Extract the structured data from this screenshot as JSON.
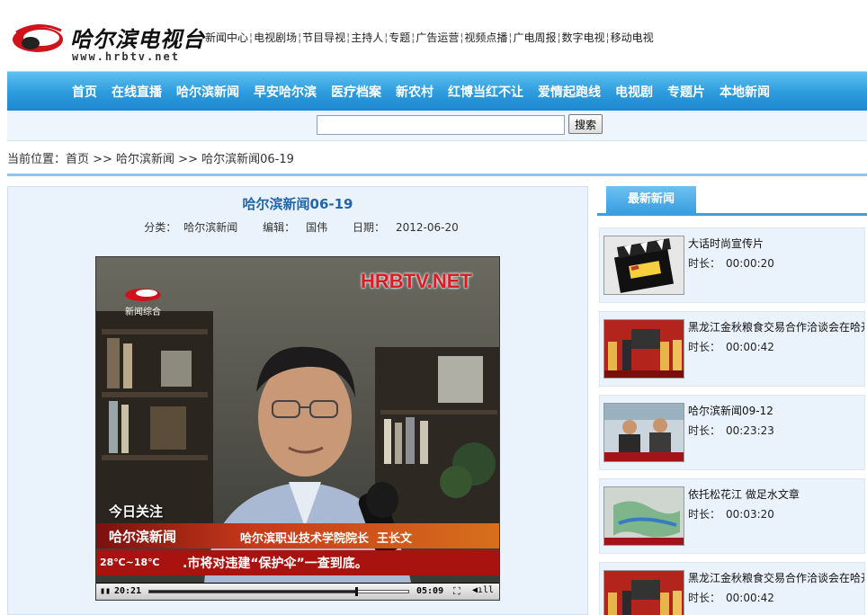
{
  "header": {
    "logo_text": "哈尔滨电视台",
    "logo_url": "www.hrbtv.net",
    "top_links": [
      "新闻中心",
      "电视剧场",
      "节目导视",
      "主持人",
      "专题",
      "广告运营",
      "视频点播",
      "广电周报",
      "数字电视",
      "移动电视"
    ],
    "separator": "¦"
  },
  "nav": {
    "items": [
      "首页",
      "在线直播",
      "哈尔滨新闻",
      "早安哈尔滨",
      "医疗档案",
      "新农村",
      "红博当红不让",
      "爱情起跑线",
      "电视剧",
      "专题片",
      "本地新闻"
    ]
  },
  "search": {
    "value": "",
    "button_label": "搜索"
  },
  "breadcrumb": {
    "text": "当前位置：首页 >> 哈尔滨新闻 >> 哈尔滨新闻06-19"
  },
  "article": {
    "title": "哈尔滨新闻06-19",
    "category_label": "分类：",
    "category": "哈尔滨新闻",
    "editor_label": "编辑：",
    "editor": "国伟",
    "date_label": "日期：",
    "date": "2012-06-20"
  },
  "player": {
    "watermark": "HRBTV.NET",
    "channel_logo_text": "新闻综合",
    "overlay_tag": "今日关注",
    "program_name": "哈尔滨新闻",
    "caption_name": "哈尔滨职业技术学院院长  王长文",
    "weather": "28℃~18℃",
    "ticker": ".市将对违建“保护伞”一查到底。",
    "current_time": "20:21",
    "duration": "05:09",
    "progress_fraction": 0.8
  },
  "sidebar": {
    "tab_label": "最新新闻",
    "duration_label": "时长：",
    "items": [
      {
        "title": "大话时尚宣传片",
        "duration": "00:00:20"
      },
      {
        "title": "黑龙江金秋粮食交易合作洽谈会在哈开幕",
        "duration": "00:00:42"
      },
      {
        "title": "哈尔滨新闻09-12",
        "duration": "00:23:23"
      },
      {
        "title": "依托松花江  做足水文章",
        "duration": "00:03:20"
      },
      {
        "title": "黑龙江金秋粮食交易合作洽谈会在哈开幕",
        "duration": "00:00:42"
      }
    ]
  },
  "colors": {
    "nav_blue": "#2c9bdc",
    "title_blue": "#2266aa",
    "panel_bg": "#eaf3fc",
    "logo_red": "#d0121b"
  }
}
